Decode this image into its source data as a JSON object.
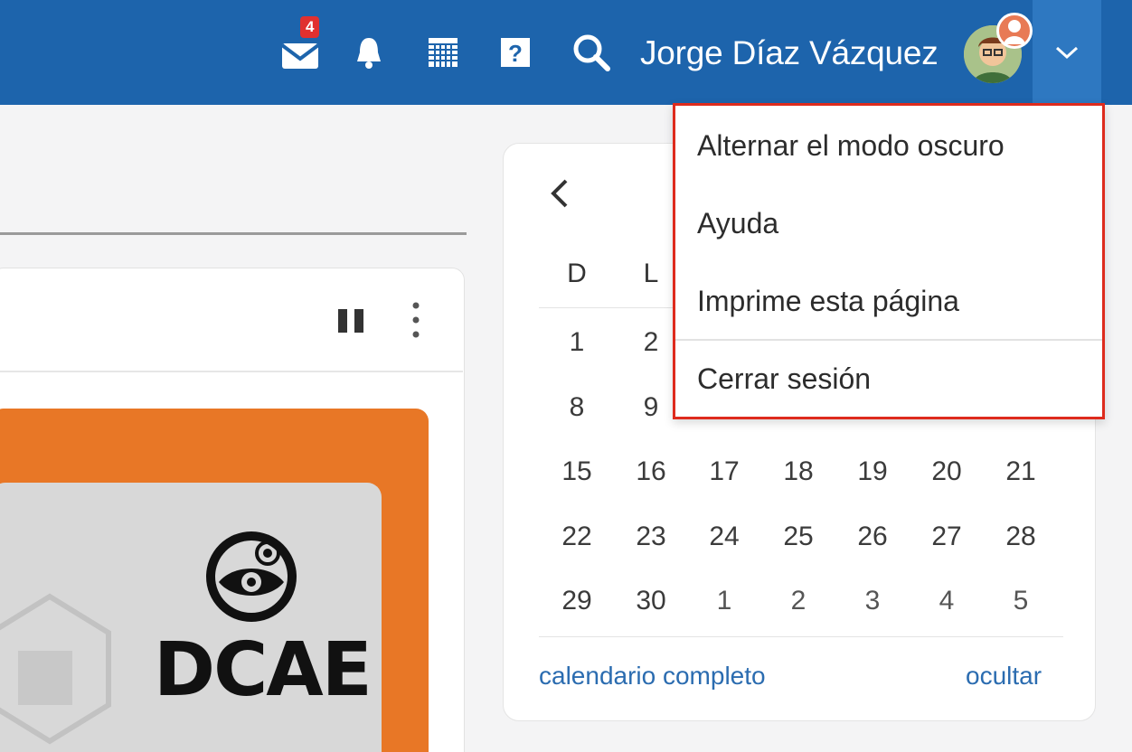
{
  "header": {
    "mail_badge": "4",
    "user_name": "Jorge Díaz Vázquez",
    "icons": [
      "mail-icon",
      "bell-icon",
      "calendar-grid-icon",
      "help-icon",
      "search-icon",
      "chevron-down-icon"
    ],
    "background_color": "#1d64ac"
  },
  "user_menu": {
    "items": [
      "Alternar el modo oscuro",
      "Ayuda",
      "Imprime esta página",
      "Cerrar sesión"
    ],
    "highlight_color": "#de2b1d"
  },
  "banner": {
    "logo_text": "DCAE",
    "accent_color": "#e87726"
  },
  "calendar": {
    "weekdays": [
      "D",
      "L"
    ],
    "weeks": [
      [
        "1",
        "2"
      ],
      [
        "8",
        "9"
      ],
      [
        "15",
        "16",
        "17",
        "18",
        "19",
        "20",
        "21"
      ],
      [
        "22",
        "23",
        "24",
        "25",
        "26",
        "27",
        "28"
      ],
      [
        "29",
        "30",
        "1",
        "2",
        "3",
        "4",
        "5"
      ]
    ],
    "full_calendar_link": "calendario completo",
    "hide_link": "ocultar"
  }
}
